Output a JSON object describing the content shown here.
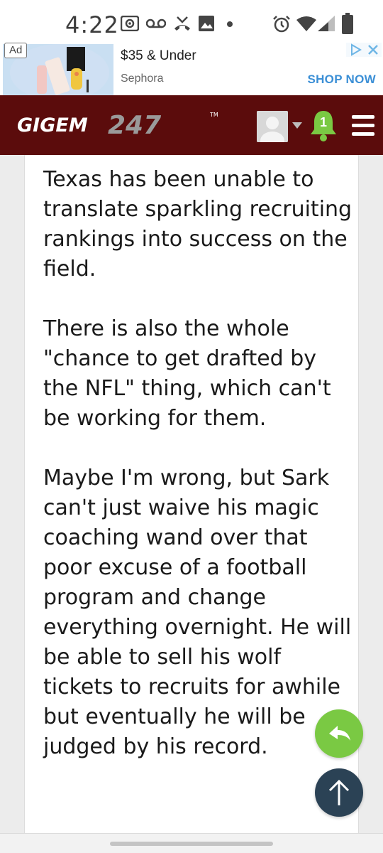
{
  "status_bar": {
    "time": "4:22",
    "icons": [
      "radio-icon",
      "voicemail-icon",
      "missed-call-icon",
      "image-icon",
      "dot-icon",
      "alarm-icon",
      "wifi-icon",
      "signal-icon",
      "battery-icon"
    ]
  },
  "ad": {
    "tag": "Ad",
    "title": "$35 & Under",
    "advertiser": "Sephora",
    "cta": "SHOP NOW",
    "colors": {
      "cta": "#3b8fd6",
      "choice": "#6fb6e6"
    }
  },
  "header": {
    "logo_text": "GIGEM",
    "logo_number": "247",
    "trademark": "TM",
    "notification_count": "1",
    "colors": {
      "background": "#5b0c0c",
      "bell": "#7ac943"
    }
  },
  "post": {
    "paragraphs": [
      "Texas has been unable to translate sparkling recruiting rankings into success on the field.",
      "There is also the whole \"chance to get drafted by the NFL\" thing, which can't be working for them.",
      "Maybe I'm wrong, but Sark can't just waive his magic coaching wand over that poor excuse of a football program and change everything overnight. He will be able to sell his wolf tickets to recruits for awhile but eventually he will be judged by his record."
    ]
  },
  "fabs": {
    "reply_icon": "reply-icon",
    "top_icon": "arrow-up-icon",
    "colors": {
      "reply": "#7ac943",
      "top": "#2b4255"
    }
  }
}
